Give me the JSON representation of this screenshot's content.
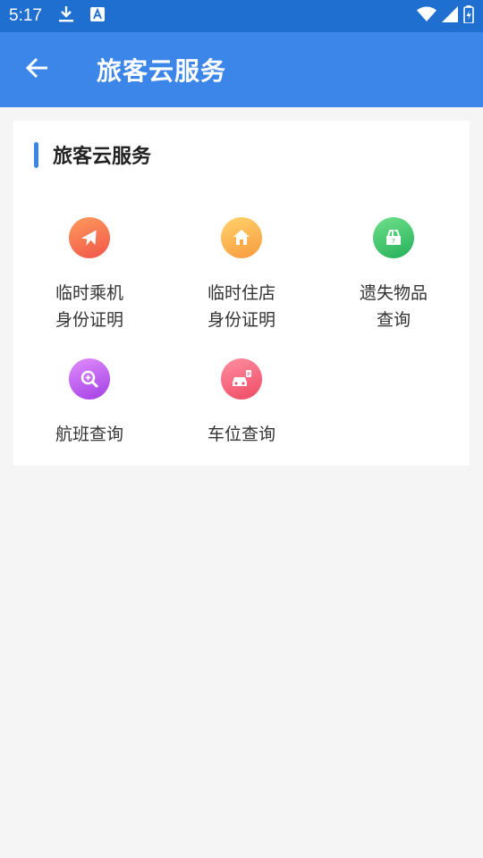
{
  "status_bar": {
    "time": "5:17"
  },
  "app_bar": {
    "title": "旅客云服务"
  },
  "section": {
    "title": "旅客云服务"
  },
  "services": [
    {
      "line1": "临时乘机",
      "line2": "身份证明",
      "icon": "airplane-icon",
      "color_from": "#ff9a5c",
      "color_to": "#f0564a"
    },
    {
      "line1": "临时住店",
      "line2": "身份证明",
      "icon": "home-icon",
      "color_from": "#ffd36b",
      "color_to": "#f99a3e"
    },
    {
      "line1": "遗失物品",
      "line2": "查询",
      "icon": "lost-item-box-icon",
      "color_from": "#6fe08a",
      "color_to": "#26b05a"
    },
    {
      "line1": "航班查询",
      "line2": "",
      "icon": "search-icon",
      "color_from": "#e08dfb",
      "color_to": "#a43ee6"
    },
    {
      "line1": "车位查询",
      "line2": "",
      "icon": "parking-car-icon",
      "color_from": "#ff8fa0",
      "color_to": "#ef4a64"
    }
  ]
}
